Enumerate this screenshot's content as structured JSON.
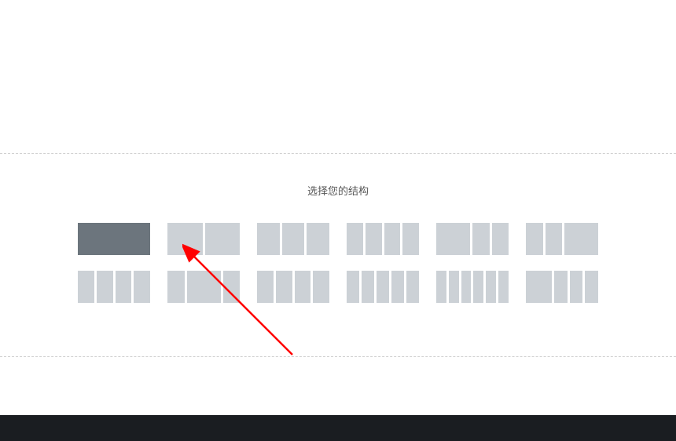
{
  "structure": {
    "title": "选择您的结构",
    "layouts_row1": [
      {
        "cols": [
          1
        ],
        "selected": true
      },
      {
        "cols": [
          1,
          1
        ]
      },
      {
        "cols": [
          1,
          1,
          1
        ]
      },
      {
        "cols": [
          1,
          1,
          1,
          1
        ]
      },
      {
        "cols": [
          2,
          1,
          1
        ]
      },
      {
        "cols": [
          1,
          1,
          2
        ]
      }
    ],
    "layouts_row2": [
      {
        "cols": [
          1,
          1,
          1,
          1
        ]
      },
      {
        "cols": [
          1,
          2,
          1
        ]
      },
      {
        "cols": [
          1,
          1,
          1,
          1
        ]
      },
      {
        "cols": [
          1,
          1,
          1,
          1,
          1
        ]
      },
      {
        "cols": [
          1,
          1,
          1,
          1,
          1,
          1
        ]
      },
      {
        "cols": [
          2,
          1,
          1,
          1
        ]
      }
    ]
  }
}
